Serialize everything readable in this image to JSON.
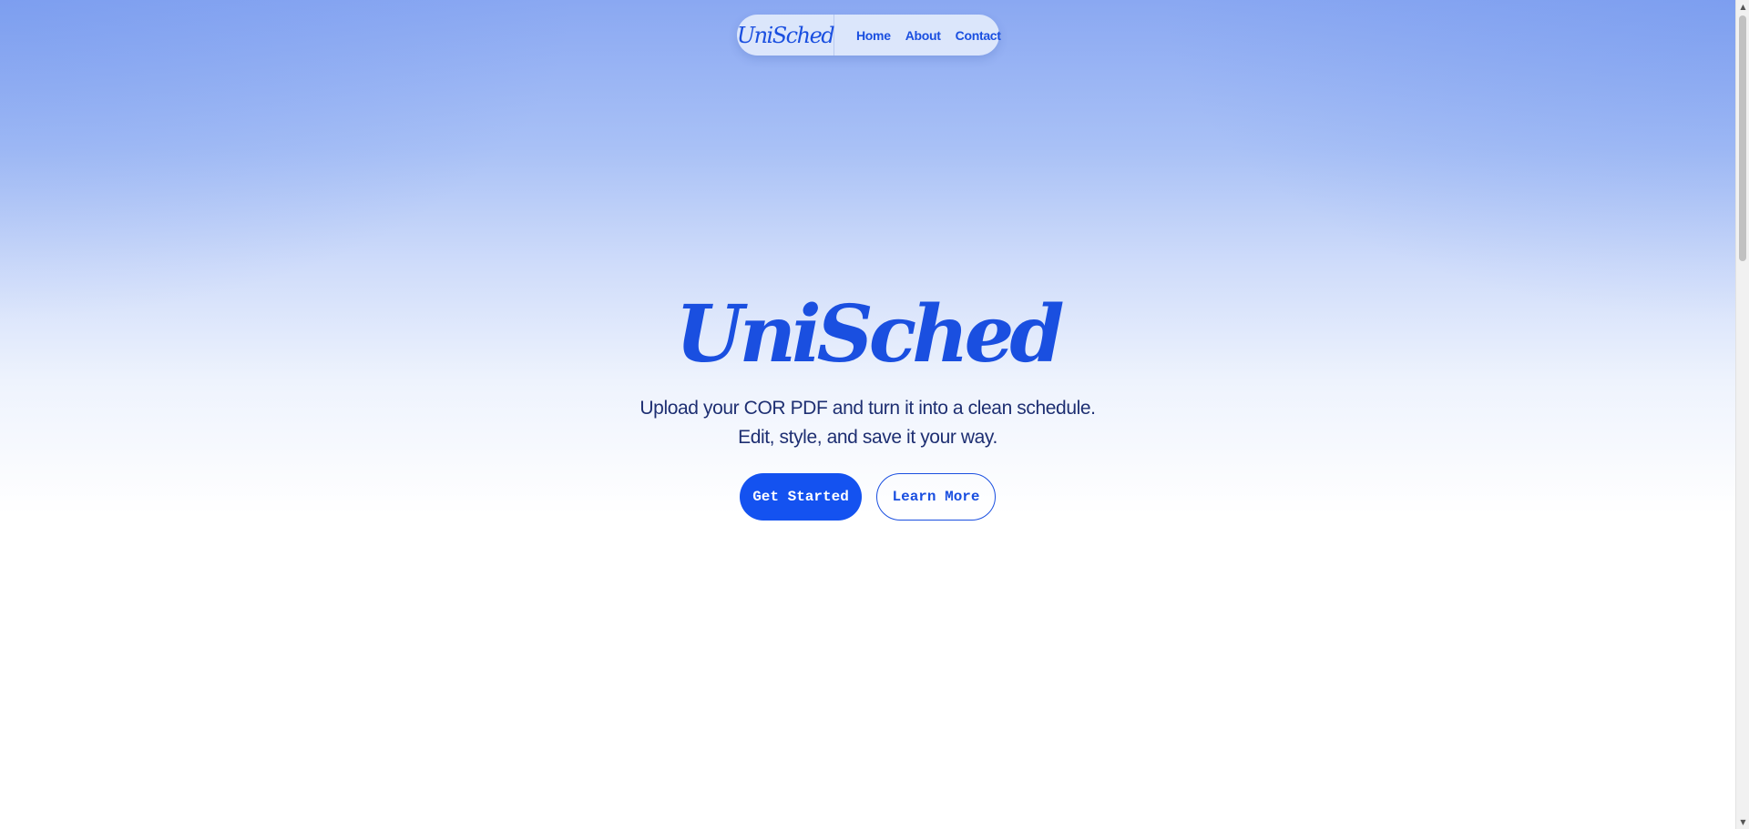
{
  "nav": {
    "logo": "UniSched",
    "links": [
      "Home",
      "About",
      "Contact"
    ]
  },
  "hero": {
    "title": "UniSched",
    "subtitle_line1": "Upload your COR PDF and turn it into a clean schedule.",
    "subtitle_line2": "Edit, style, and save it your way.",
    "primary_button": "Get Started",
    "secondary_button": "Learn More"
  },
  "colors": {
    "accent": "#1452f0",
    "text_dark": "#1e2f72",
    "background_top": "#8aa8f2",
    "background_bottom": "#ffffff"
  },
  "icons": {
    "scroll_up": "chevron-up-icon",
    "scroll_down": "chevron-down-icon"
  }
}
